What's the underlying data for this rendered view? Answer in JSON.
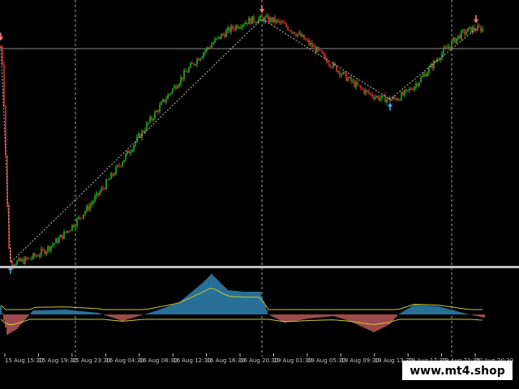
{
  "watermark": "www.mt4.shop",
  "colors": {
    "background": "#000000",
    "bull_candle": "#22b022",
    "bear_candle": "#d23232",
    "zigzag": "#bfbfbf",
    "grid": "#d0d0d0",
    "hist_up": "#3a9fd8",
    "hist_down": "#e06a6a",
    "signal_line": "#c8c832",
    "arrow_up": "#3fa9f5",
    "arrow_down": "#f08080",
    "separator": "#c0c0c0"
  },
  "chart_data": {
    "type": "line",
    "x_tick_labels": [
      "15 Aug 15:30",
      "15 Aug 19:30",
      "15 Aug 23:30",
      "16 Aug 04:30",
      "16 Aug 08:30",
      "16 Aug 12:30",
      "16 Aug 16:30",
      "16 Aug 20:30",
      "19 Aug 01:30",
      "19 Aug 05:30",
      "19 Aug 09:30",
      "19 Aug 13:30",
      "19 Aug 17:30",
      "19 Aug 21:30",
      "20 Aug 20:30"
    ],
    "zigzag_points": [
      {
        "bar": 0,
        "value": 0.86
      },
      {
        "bar": 6,
        "value": 0.0
      },
      {
        "bar": 161,
        "value": 0.97
      },
      {
        "bar": 240,
        "value": 0.65
      },
      {
        "bar": 293,
        "value": 0.93
      }
    ],
    "signal_arrows": [
      {
        "bar": 0,
        "direction": "down"
      },
      {
        "bar": 6,
        "direction": "up"
      },
      {
        "bar": 161,
        "direction": "down"
      },
      {
        "bar": 240,
        "direction": "up"
      },
      {
        "bar": 293,
        "direction": "down"
      }
    ]
  }
}
